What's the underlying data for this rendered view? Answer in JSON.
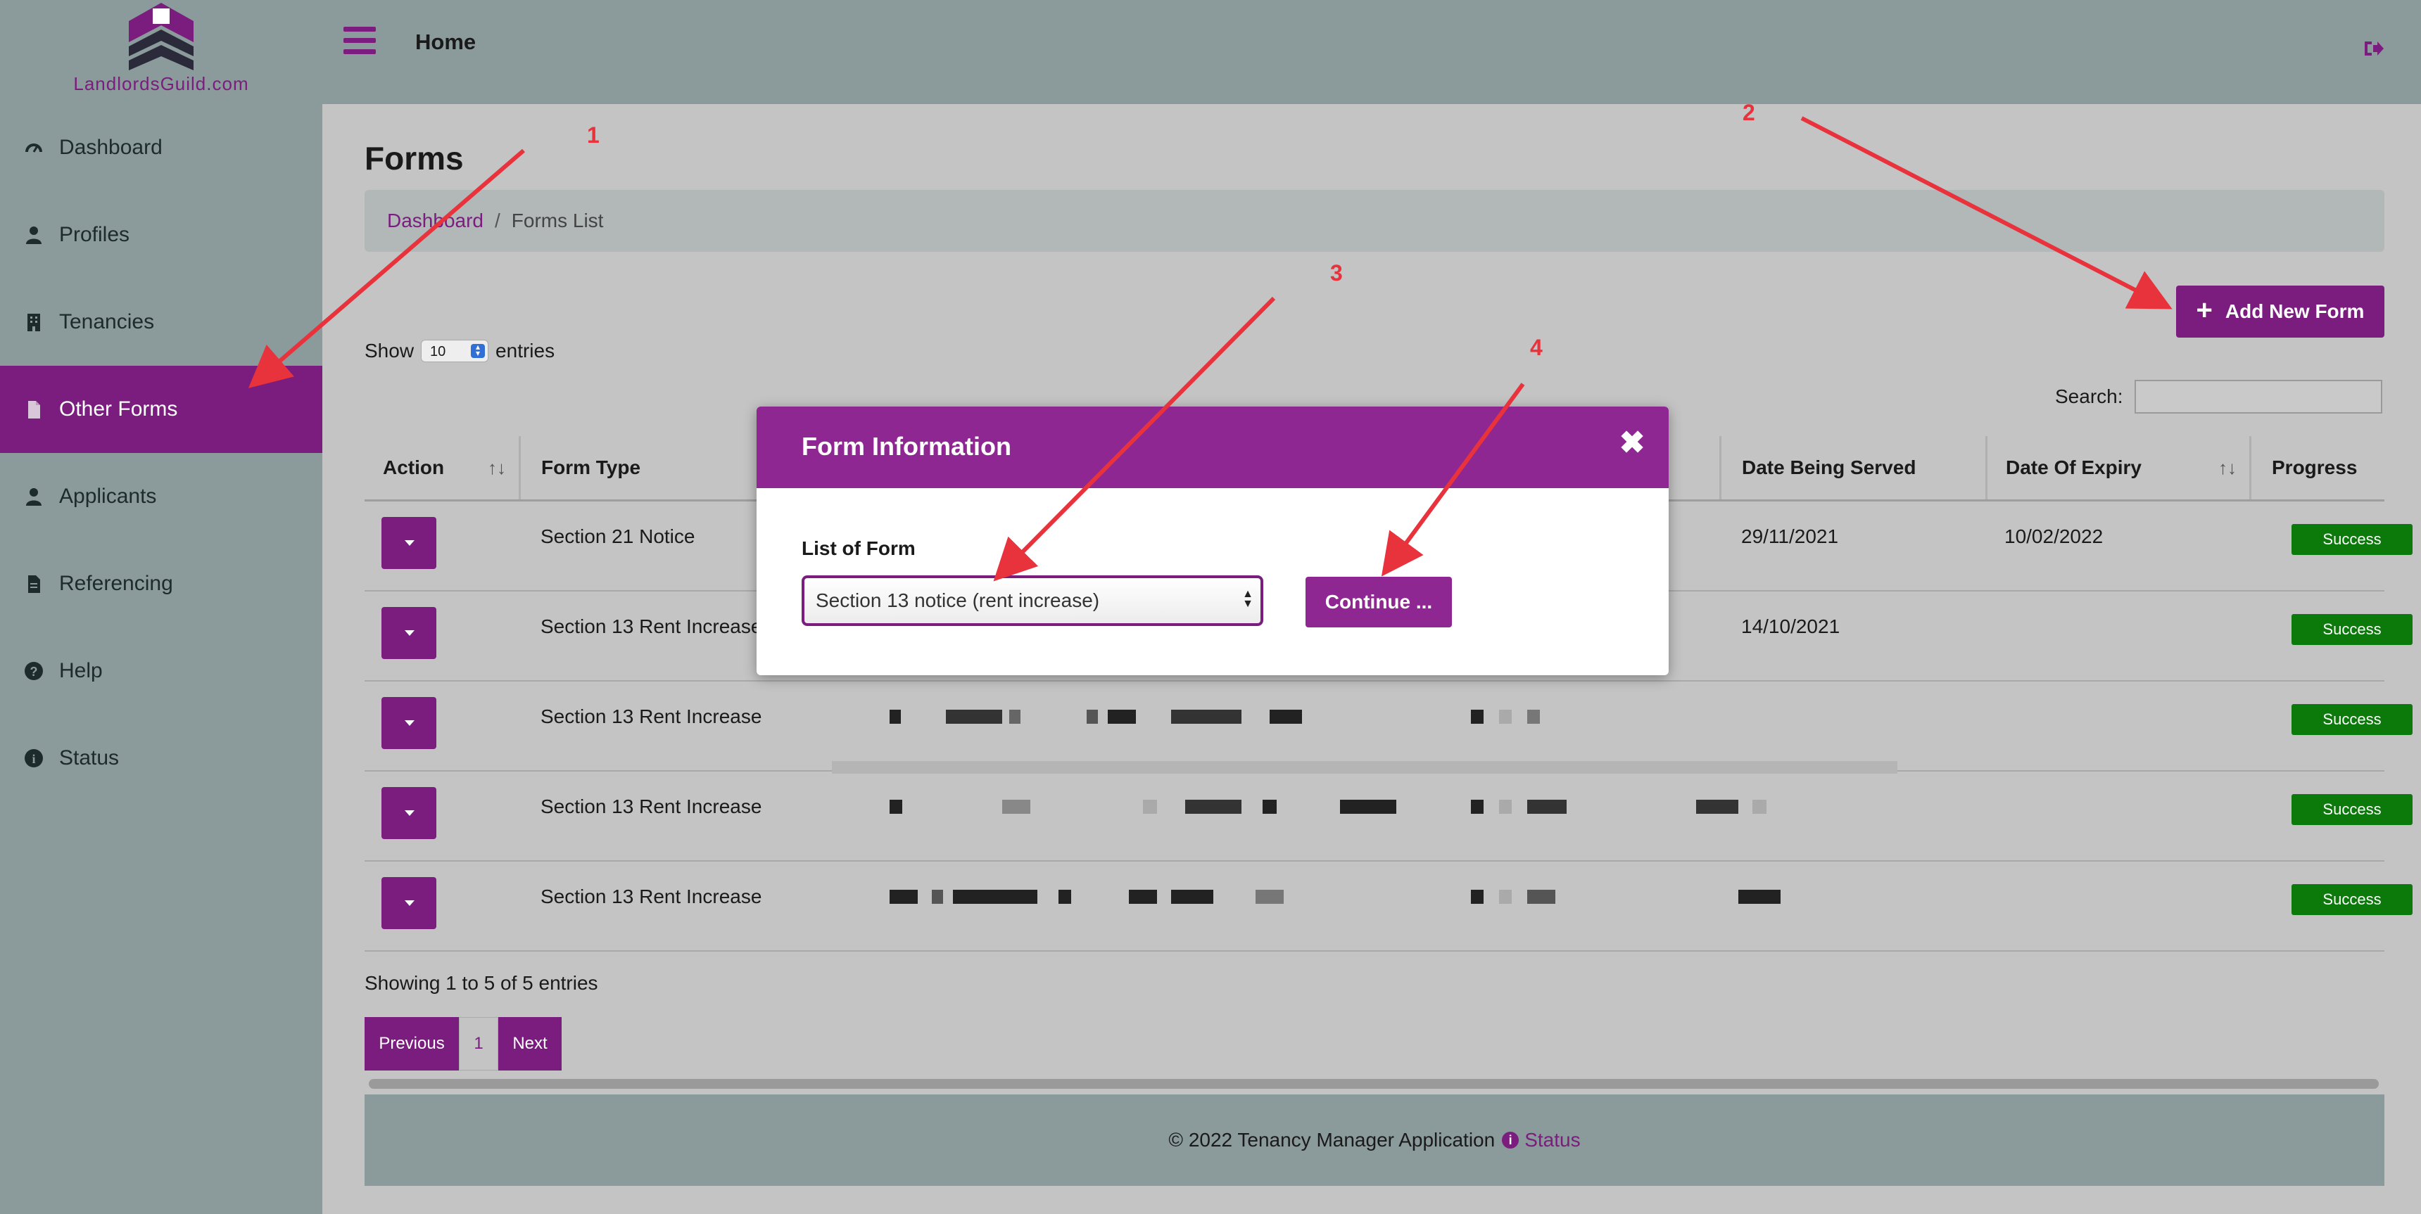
{
  "brand": {
    "logo_text": "LandlordsGuild.com"
  },
  "sidebar": {
    "items": [
      {
        "label": "Dashboard",
        "icon": "speedometer-icon",
        "active": false
      },
      {
        "label": "Profiles",
        "icon": "user-icon",
        "active": false
      },
      {
        "label": "Tenancies",
        "icon": "building-icon",
        "active": false
      },
      {
        "label": "Other Forms",
        "icon": "file-icon",
        "active": true
      },
      {
        "label": "Applicants",
        "icon": "user-icon",
        "active": false
      },
      {
        "label": "Referencing",
        "icon": "file-text-icon",
        "active": false
      },
      {
        "label": "Help",
        "icon": "question-circle-icon",
        "active": false
      },
      {
        "label": "Status",
        "icon": "info-circle-icon",
        "active": false
      }
    ]
  },
  "topbar": {
    "title": "Home",
    "logout_icon": "sign-out-icon"
  },
  "page": {
    "title": "Forms",
    "breadcrumb": {
      "link": "Dashboard",
      "separator": "/",
      "current": "Forms List"
    },
    "add_button": {
      "icon": "plus-icon",
      "label": "Add New Form"
    }
  },
  "table_controls": {
    "show_label": "Show",
    "entries_value": "10",
    "entries_label": "entries",
    "search_label": "Search:"
  },
  "table": {
    "columns": [
      {
        "label": "Action",
        "sortable": true
      },
      {
        "label": "Form Type",
        "sortable": false
      },
      {
        "label": "",
        "sortable": true
      },
      {
        "label": "Date Being Served",
        "sortable": false
      },
      {
        "label": "Date Of Expiry",
        "sortable": true
      },
      {
        "label": "Progress",
        "sortable": false
      }
    ],
    "sort_glyph": "↑↓",
    "rows": [
      {
        "form_type": "Section 21 Notice",
        "date_served": "29/11/2021",
        "date_expiry": "10/02/2022",
        "progress": "Success"
      },
      {
        "form_type": "Section 13 Rent Increase",
        "date_served": "14/10/2021",
        "date_expiry": "",
        "progress": "Success"
      },
      {
        "form_type": "Section 13 Rent Increase",
        "date_served": "",
        "date_expiry": "",
        "progress": "Success"
      },
      {
        "form_type": "Section 13 Rent Increase",
        "date_served": "",
        "date_expiry": "",
        "progress": "Success"
      },
      {
        "form_type": "Section 13 Rent Increase",
        "date_served": "",
        "date_expiry": "",
        "progress": "Success"
      }
    ]
  },
  "pagination": {
    "showing_text": "Showing 1 to 5 of 5 entries",
    "previous": "Previous",
    "page": "1",
    "next": "Next"
  },
  "footer": {
    "copyright": "© 2022 Tenancy Manager Application",
    "status_link": "Status"
  },
  "modal": {
    "title": "Form Information",
    "close_icon": "close-icon",
    "field_label": "List of Form",
    "selected_option": "Section 13 notice (rent increase)",
    "continue_label": "Continue ..."
  },
  "annotations": {
    "labels": [
      "1",
      "2",
      "3",
      "4"
    ],
    "color": "#e8323c"
  },
  "colors": {
    "brand_purple": "#7a1d7e",
    "modal_header": "#8e2791",
    "success_green": "#0b7a0b",
    "sidebar_bg": "#8b9a9a"
  }
}
